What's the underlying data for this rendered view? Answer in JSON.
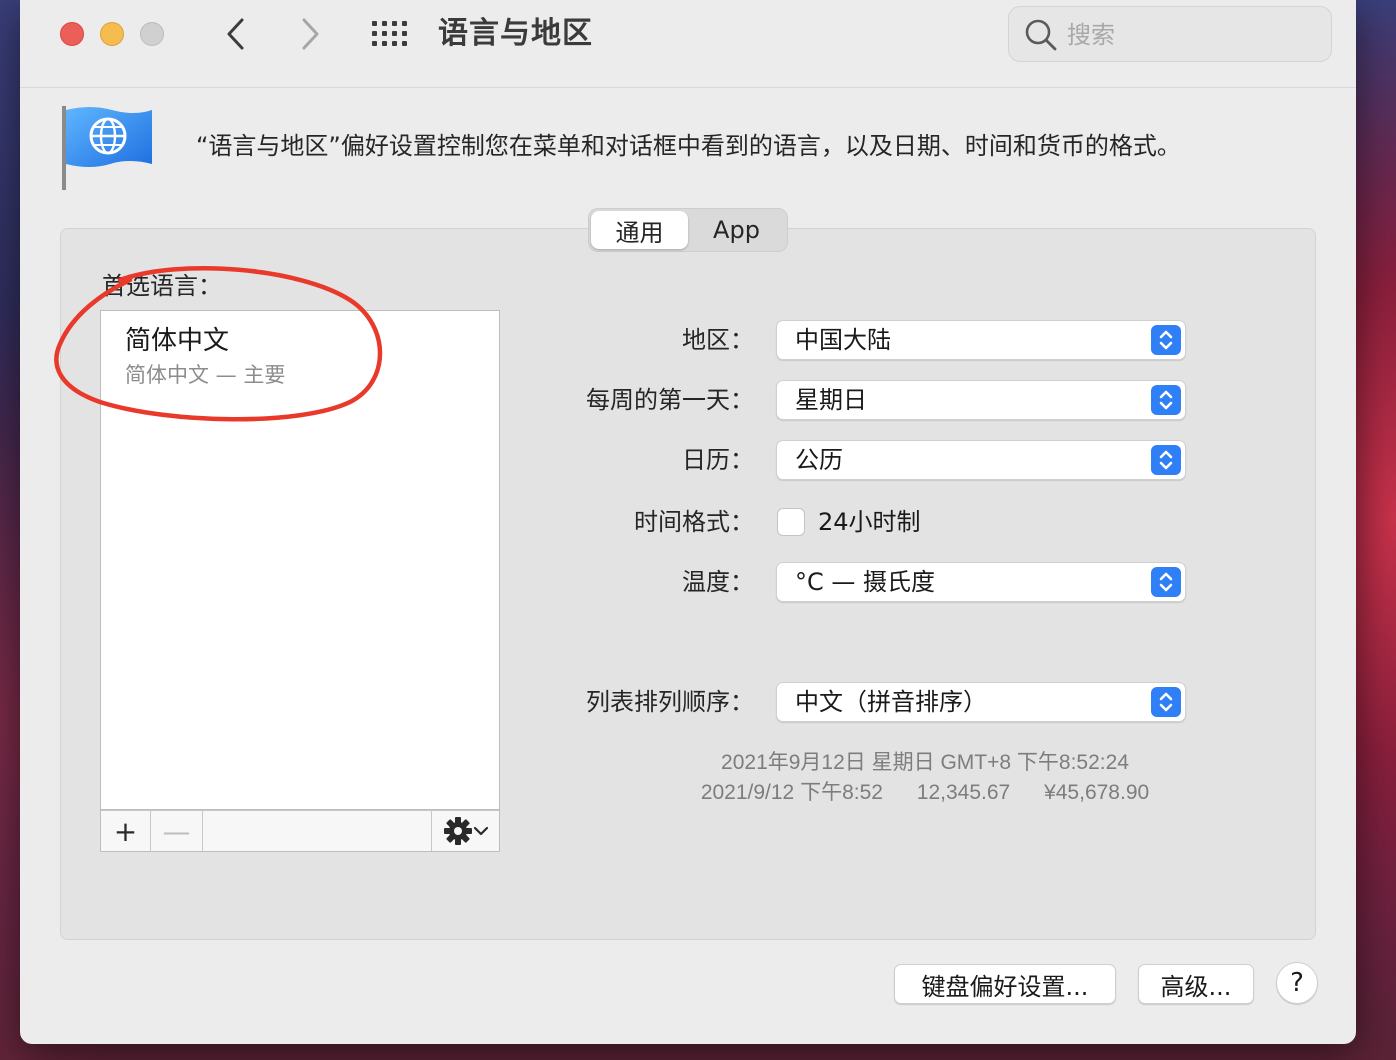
{
  "window": {
    "title": "语言与地区",
    "search_placeholder": "搜索"
  },
  "header": {
    "description": "“语言与地区”偏好设置控制您在菜单和对话框中看到的语言，以及日期、时间和货币的格式。"
  },
  "tabs": [
    {
      "label": "通用",
      "active": true
    },
    {
      "label": "App",
      "active": false
    }
  ],
  "languages": {
    "label": "首选语言：",
    "items": [
      {
        "name": "简体中文",
        "subtitle": "简体中文 — 主要"
      }
    ],
    "add_label": "+",
    "remove_label": "—"
  },
  "settings": {
    "region": {
      "label": "地区：",
      "value": "中国大陆"
    },
    "first_day": {
      "label": "每周的第一天：",
      "value": "星期日"
    },
    "calendar": {
      "label": "日历：",
      "value": "公历"
    },
    "time_format": {
      "label": "时间格式：",
      "checkbox_label": "24小时制",
      "checked": false
    },
    "temperature": {
      "label": "温度：",
      "value": "°C — 摄氏度"
    },
    "list_sort": {
      "label": "列表排列顺序：",
      "value": "中文（拼音排序）"
    }
  },
  "sample": {
    "line1": "2021年9月12日 星期日 GMT+8 下午8:52:24",
    "date_short": "2021/9/12 下午8:52",
    "number": "12,345.67",
    "currency": "¥45,678.90"
  },
  "buttons": {
    "keyboard": "键盘偏好设置...",
    "advanced": "高级...",
    "help": "?"
  },
  "colors": {
    "close": "#ec5f59",
    "minimize": "#f5bd4f",
    "accent": "#2f7ff6",
    "annotation": "#e8392a"
  }
}
